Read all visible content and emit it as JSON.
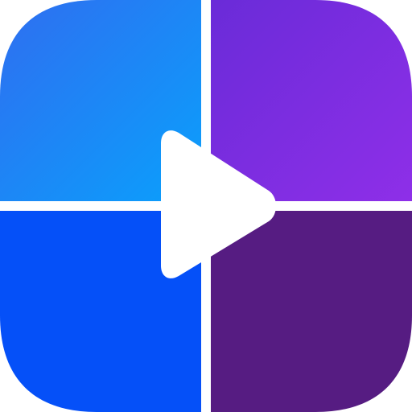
{
  "icon": {
    "name": "video-collage-app-icon",
    "quadrants": [
      {
        "name": "top-left-tile",
        "gradient": [
          "#2f6ef0",
          "#0aa0fc"
        ]
      },
      {
        "name": "top-right-tile",
        "gradient": [
          "#6a2bd8",
          "#8e2fe8"
        ]
      },
      {
        "name": "bottom-left-tile",
        "color": "#0550f8"
      },
      {
        "name": "bottom-right-tile",
        "color": "#561c82"
      }
    ],
    "play_symbol": {
      "name": "play-icon",
      "color": "#ffffff"
    },
    "divider_color": "#ffffff"
  }
}
